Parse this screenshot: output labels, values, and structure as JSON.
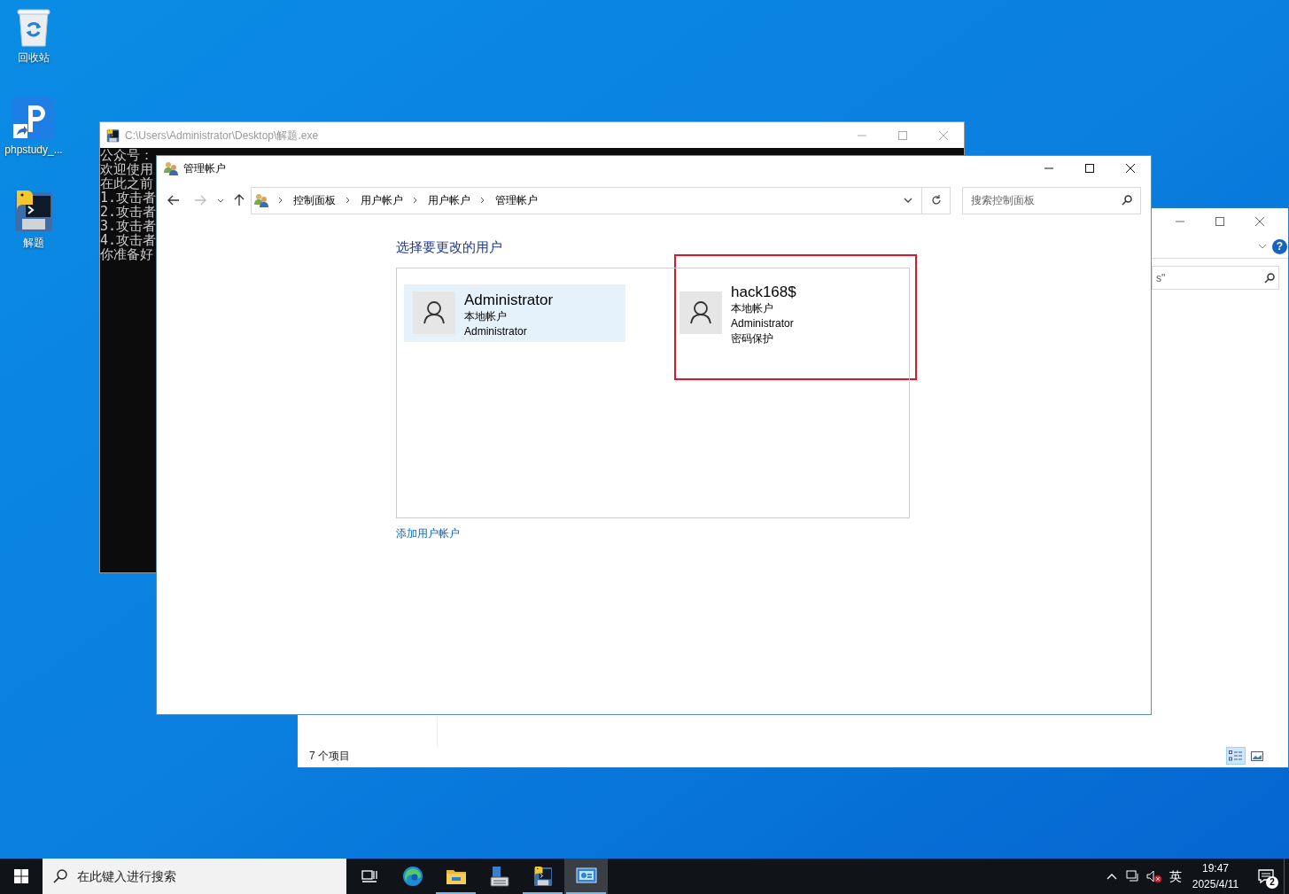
{
  "desktop_icons": [
    {
      "kind": "recycle",
      "label": "回收站"
    },
    {
      "kind": "shortcut",
      "label": "phpstudy_..."
    },
    {
      "kind": "python",
      "label": "解题"
    }
  ],
  "explorer_window": {
    "help_label": "?",
    "search_text": "s\"",
    "status": "7 个项目",
    "view_buttons": [
      {
        "kind": "details",
        "selected": true
      },
      {
        "kind": "tiles",
        "selected": false
      }
    ]
  },
  "console_window": {
    "title": "C:\\Users\\Administrator\\Desktop\\解题.exe",
    "lines": [
      "公众号：",
      "欢迎使用",
      "在此之前",
      "1.攻击者",
      "2.攻击者",
      "3.攻击者",
      "4.攻击者",
      "你准备好"
    ]
  },
  "control_panel": {
    "title": "管理帐户",
    "breadcrumb": [
      "控制面板",
      "用户帐户",
      "用户帐户",
      "管理帐户"
    ],
    "search_placeholder": "搜索控制面板",
    "heading": "选择要更改的用户",
    "accounts": [
      {
        "name": "Administrator",
        "details": [
          "本地帐户",
          "Administrator"
        ],
        "selected": true,
        "highlighted": false
      },
      {
        "name": "hack168$",
        "details": [
          "本地帐户",
          "Administrator",
          "密码保护"
        ],
        "selected": false,
        "highlighted": true
      }
    ],
    "add_link": "添加用户帐户"
  },
  "taskbar": {
    "search_placeholder": "在此键入进行搜索",
    "apps": [
      {
        "kind": "task-view",
        "open": false,
        "selected": false
      },
      {
        "kind": "browser",
        "open": false,
        "selected": false
      },
      {
        "kind": "folder",
        "open": true,
        "selected": false
      },
      {
        "kind": "server",
        "open": false,
        "selected": false
      },
      {
        "kind": "python",
        "open": true,
        "selected": false
      },
      {
        "kind": "control-panel",
        "open": true,
        "selected": true
      }
    ],
    "ime": "英",
    "time": "19:47",
    "date": "2025/4/11",
    "notifications": "2"
  }
}
